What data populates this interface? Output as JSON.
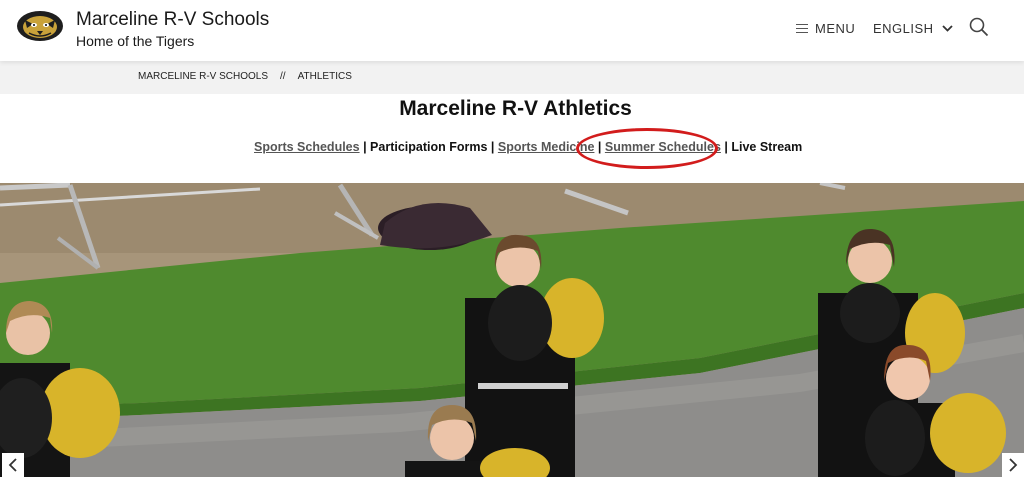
{
  "header": {
    "title": "Marceline R-V Schools",
    "subtitle": "Home of the Tigers",
    "menu_label": "MENU",
    "language_label": "ENGLISH"
  },
  "breadcrumb": {
    "items": [
      "MARCELINE R-V SCHOOLS",
      "ATHLETICS"
    ],
    "separator": "//"
  },
  "page": {
    "title": "Marceline R-V Athletics"
  },
  "links": {
    "sports_schedules": "Sports Schedules",
    "participation_forms": "Participation Forms",
    "sports_medicine": "Sports Medicine",
    "summer_schedules": "Summer Schedules",
    "live_stream": "Live Stream",
    "separator": " | "
  },
  "colors": {
    "highlight_oval": "#d21c1c",
    "link": "#555555",
    "breadcrumb_bg": "#f2f2f2",
    "pom_gold": "#d8b42a"
  },
  "icons": {
    "menu": "hamburger-icon",
    "language": "chevron-down-icon",
    "search": "search-icon",
    "prev": "chevron-left-icon",
    "next": "chevron-right-icon",
    "logo": "tiger-logo"
  }
}
